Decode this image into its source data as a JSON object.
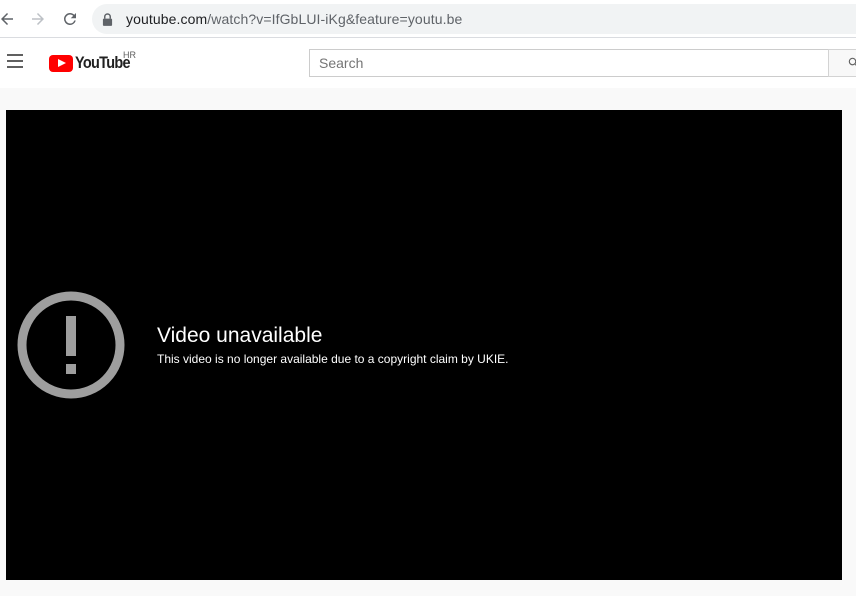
{
  "browser": {
    "url_host": "youtube.com",
    "url_path": "/watch?v=IfGbLUI-iKg&feature=youtu.be"
  },
  "header": {
    "logo_text": "YouTube",
    "region": "HR",
    "search_placeholder": "Search"
  },
  "player": {
    "error_title": "Video unavailable",
    "error_reason": "This video is no longer available due to a copyright claim by UKIE."
  },
  "colors": {
    "brand": "#ff0000",
    "player_bg": "#000000",
    "error_icon": "#9e9e9e"
  }
}
